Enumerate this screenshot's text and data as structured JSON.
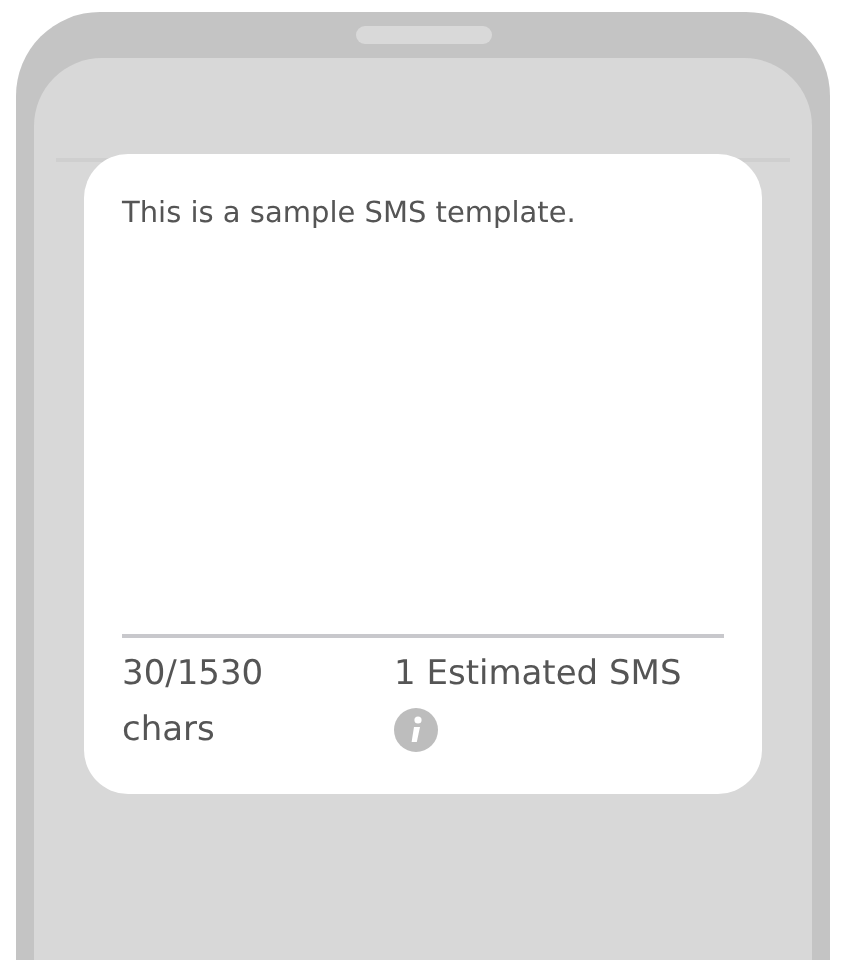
{
  "message": {
    "text": "This is a sample SMS template."
  },
  "footer": {
    "char_count": "30/1530 chars",
    "estimate": "1 Estimated SMS"
  }
}
